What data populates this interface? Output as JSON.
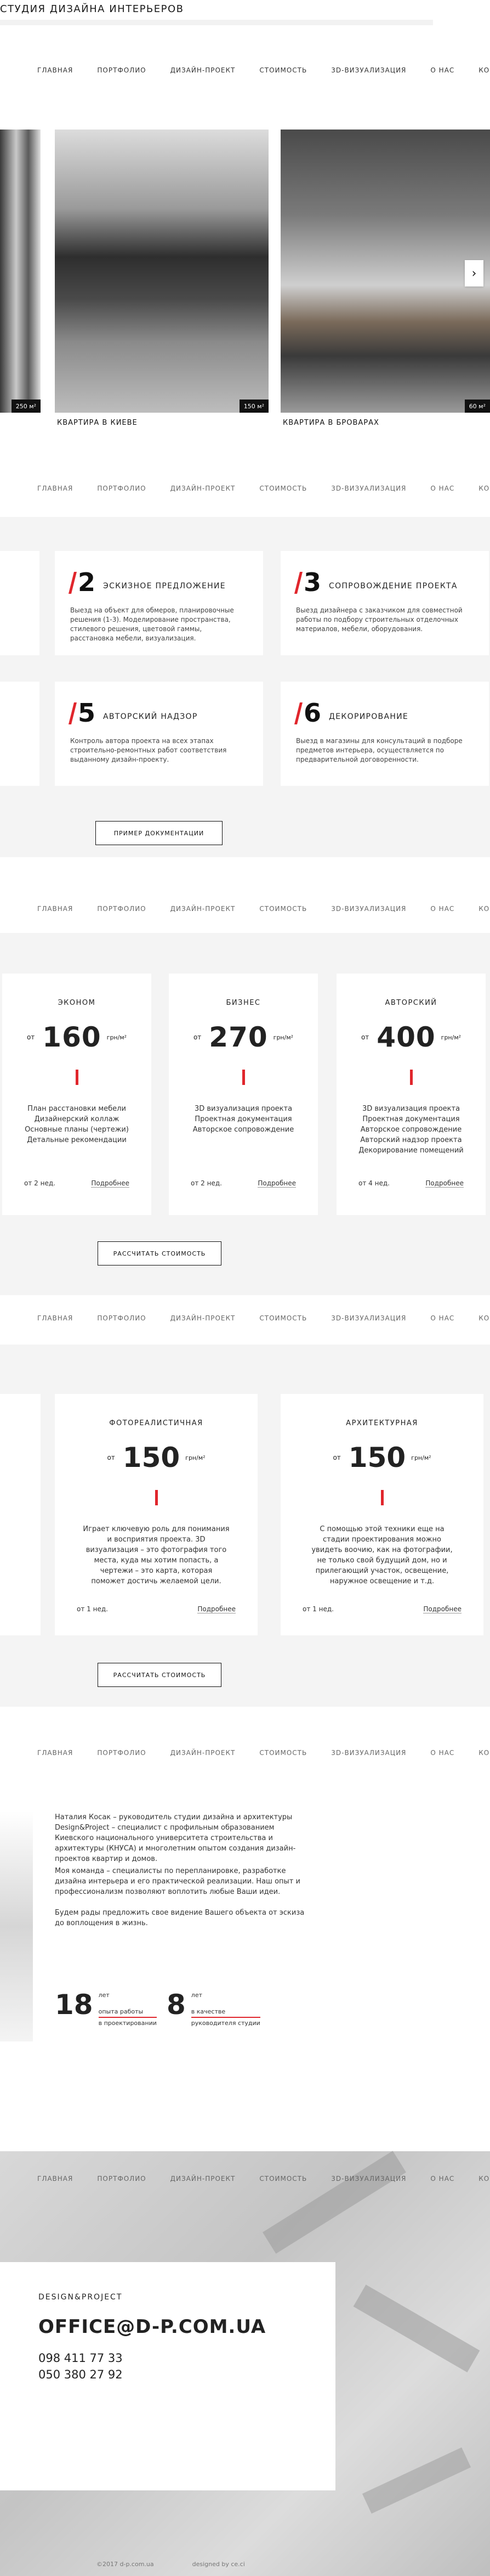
{
  "header": {
    "logo_text": "СТУДИЯ ДИЗАЙНА ИНТЕРЬЕРОВ"
  },
  "nav": [
    "ГЛАВНАЯ",
    "ПОРТФОЛИО",
    "ДИЗАЙН-ПРОЕКТ",
    "СТОИМОСТЬ",
    "3D-ВИЗУАЛИЗАЦИЯ",
    "О НАС",
    "КОНТАКТЫ"
  ],
  "portfolio": {
    "items": [
      {
        "caption": "",
        "area": "250 м²"
      },
      {
        "caption": "КВАРТИРА В КИЕВЕ",
        "area": "150 м²"
      },
      {
        "caption": "КВАРТИРА В БРОВАРАХ",
        "area": "60 м²"
      }
    ],
    "next_arrow": "›"
  },
  "services": {
    "items": [
      {
        "num": "2",
        "title": "ЭСКИЗНОЕ ПРЕДЛОЖЕНИЕ",
        "desc": "Выезд на объект для обмеров, планировочные решения (1-3). Моделирование пространства, стилевого решения, цветовой гаммы, расстановка мебели, визуализация."
      },
      {
        "num": "3",
        "title": "СОПРОВОЖДЕНИЕ ПРОЕКТА",
        "desc": "Выезд дизайнера с заказчиком для совместной работы по подбору строительных отделочных материалов, мебели, оборудования."
      },
      {
        "num": "5",
        "title": "АВТОРСКИЙ НАДЗОР",
        "desc": "Контроль автора проекта на всех этапах строительно-ремонтных работ соответствия выданному дизайн-проекту."
      },
      {
        "num": "6",
        "title": "ДЕКОРИРОВАНИЕ",
        "desc": "Выезд в магазины для консультаций в подборе предметов интерьера, осуществляется по предварительной договоренности."
      }
    ],
    "button": "ПРИМЕР ДОКУМЕНТАЦИИ"
  },
  "pricing": {
    "from": "от",
    "unit": "грн/м²",
    "more": "Подробнее",
    "cards": [
      {
        "name": "ЭКОНОМ",
        "price": "160",
        "items": [
          "План расстановки мебели",
          "Дизайнерский коллаж",
          "Основные планы (чертежи)",
          "Детальные рекомендации"
        ],
        "term": "от 2 нед."
      },
      {
        "name": "БИЗНЕС",
        "price": "270",
        "items": [
          "3D визуализация проекта",
          "Проектная документация",
          "Авторское сопровождение"
        ],
        "term": "от 2 нед."
      },
      {
        "name": "АВТОРСКИЙ",
        "price": "400",
        "items": [
          "3D визуализация проекта",
          "Проектная документация",
          "Авторское сопровождение",
          "Авторский надзор проекта",
          "Декорирование помещений"
        ],
        "term": "от 4 нед."
      }
    ],
    "button": "РАССЧИТАТЬ СТОИМОСТЬ"
  },
  "visualization": {
    "cards": [
      {
        "name": "ФОТОРЕАЛИСТИЧНАЯ",
        "price": "150",
        "desc": "Играет ключевую роль для понимания и восприятия проекта. 3D визуализация – это фотография того места, куда мы хотим попасть, а чертежи – это карта, которая поможет достичь желаемой цели.",
        "term": "от 1 нед."
      },
      {
        "name": "АРХИТЕКТУРНАЯ",
        "price": "150",
        "desc": "С помощью этой техники еще на стадии проектирования можно увидеть воочию, как на фотографии, не только свой будущий дом, но и прилегающий участок, освещение, наружное освещение и т.д.",
        "term": "от 1 нед."
      }
    ],
    "button": "РАССЧИТАТЬ СТОИМОСТЬ"
  },
  "about": {
    "paragraphs": [
      "Наталия Косак – руководитель студии дизайна и архитектуры Design&Project – специалист с профильным образованием Киевского национального университета строительства и архитектуры (КНУСА) и многолетним опытом создания дизайн-проектов квартир и домов.",
      "Моя команда – специалисты по перепланировке, разработке дизайна интерьера и его практической реализации. Наш опыт и профессионализм позволяют воплотить любые Ваши идеи.",
      "Будем рады предложить свое видение Вашего объекта от эскиза до воплощения в жизнь."
    ],
    "stats": [
      {
        "n": "18",
        "sup": "лет",
        "l1": "опыта работы",
        "l2": "в проектировании"
      },
      {
        "n": "8",
        "sup": "лет",
        "l1": "в качестве",
        "l2": "руководителя студии"
      }
    ]
  },
  "contact": {
    "brand": "DESIGN&PROJECT",
    "email": "OFFICE@D-P.COM.UA",
    "phones": [
      "098 411 77 33",
      "050 380 27 92"
    ]
  },
  "footer": {
    "copyright": "©2017 d-p.com.ua",
    "credit": "designed by ce.ci"
  },
  "colors": {
    "accent": "#e0262c",
    "text": "#222222",
    "section_bg": "#f4f4f4"
  }
}
